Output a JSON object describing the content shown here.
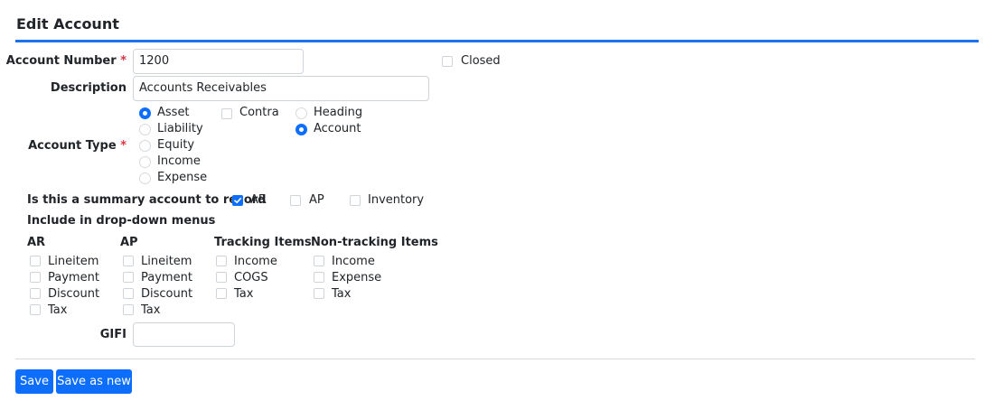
{
  "page": {
    "title": "Edit Account"
  },
  "account_number": {
    "label": "Account Number",
    "required": "*",
    "value": "1200"
  },
  "closed": {
    "label": "Closed",
    "checked": false
  },
  "description": {
    "label": "Description",
    "value": "Accounts Receivables"
  },
  "account_type": {
    "label": "Account Type",
    "required": "*",
    "options": [
      {
        "label": "Asset",
        "selected": true
      },
      {
        "label": "Liability",
        "selected": false
      },
      {
        "label": "Equity",
        "selected": false
      },
      {
        "label": "Income",
        "selected": false
      },
      {
        "label": "Expense",
        "selected": false
      }
    ],
    "contra": {
      "label": "Contra",
      "checked": false
    },
    "kind_options": [
      {
        "label": "Heading",
        "selected": false
      },
      {
        "label": "Account",
        "selected": true
      }
    ]
  },
  "summary": {
    "label": "Is this a summary account to record",
    "options": [
      {
        "label": "AR",
        "checked": true
      },
      {
        "label": "AP",
        "checked": false
      },
      {
        "label": "Inventory",
        "checked": false
      }
    ]
  },
  "dropdown_menus": {
    "label": "Include in drop-down menus",
    "groups": [
      {
        "title": "AR",
        "items": [
          "Lineitem",
          "Payment",
          "Discount",
          "Tax"
        ]
      },
      {
        "title": "AP",
        "items": [
          "Lineitem",
          "Payment",
          "Discount",
          "Tax"
        ]
      },
      {
        "title": "Tracking Items",
        "items": [
          "Income",
          "COGS",
          "Tax"
        ]
      },
      {
        "title": "Non-tracking Items",
        "items": [
          "Income",
          "Expense",
          "Tax"
        ]
      }
    ]
  },
  "gifi": {
    "label": "GIFI",
    "value": ""
  },
  "buttons": {
    "save": "Save",
    "save_as_new": "Save as new"
  },
  "colors": {
    "accent": "#0d6efd",
    "title_rule": "#1a73e8",
    "required": "#dc3545"
  }
}
